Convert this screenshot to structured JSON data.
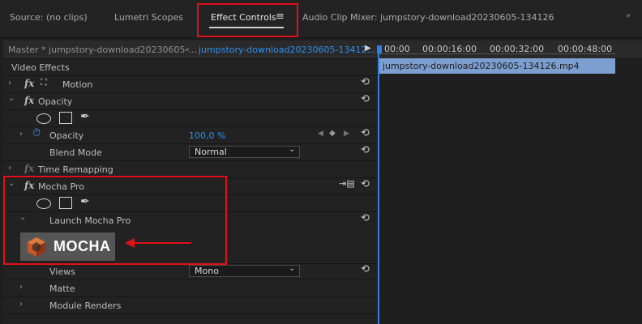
{
  "tabs": [
    {
      "label": "Source: (no clips)"
    },
    {
      "label": "Lumetri Scopes"
    },
    {
      "label": "Effect Controls",
      "menu_icon": "hamburger-icon"
    },
    {
      "label": "Audio Clip Mixer: jumpstory-download20230605-134126"
    }
  ],
  "header": {
    "master": "Master * jumpstory-download20230605-...",
    "clip": "jumpstory-download20230605-13412..."
  },
  "timeline": {
    "times": [
      "00:00",
      "00:00:16:00",
      "00:00:32:00",
      "00:00:48:00"
    ],
    "clip_name": "jumpstory-download20230605-134126.mp4"
  },
  "effects": {
    "section": "Video Effects",
    "motion": "Motion",
    "opacity": "Opacity",
    "opacity_param": "Opacity",
    "opacity_value": "100,0 %",
    "blend_mode_label": "Blend Mode",
    "blend_mode_value": "Normal",
    "time_remapping": "Time Remapping",
    "mocha_pro": "Mocha Pro",
    "launch_mocha": "Launch Mocha Pro",
    "mocha_logo_text": "MOCHA",
    "views_label": "Views",
    "views_value": "Mono",
    "matte": "Matte",
    "module_renders": "Module Renders"
  },
  "colors": {
    "accent_blue": "#2e8ff0",
    "highlight_red": "#e0101a",
    "clip_color": "#7d9fd0"
  }
}
